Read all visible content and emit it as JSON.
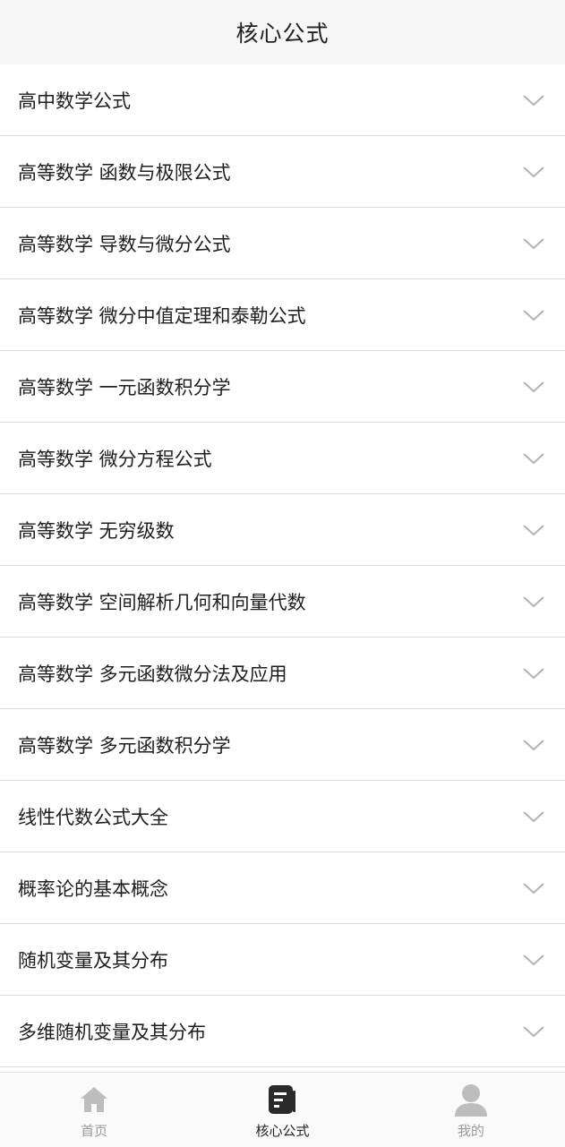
{
  "header": {
    "title": "核心公式"
  },
  "list": {
    "items": [
      {
        "label": "高中数学公式"
      },
      {
        "label": "高等数学 函数与极限公式"
      },
      {
        "label": "高等数学 导数与微分公式"
      },
      {
        "label": "高等数学 微分中值定理和泰勒公式"
      },
      {
        "label": "高等数学 一元函数积分学"
      },
      {
        "label": "高等数学 微分方程公式"
      },
      {
        "label": "高等数学 无穷级数"
      },
      {
        "label": "高等数学 空间解析几何和向量代数"
      },
      {
        "label": "高等数学 多元函数微分法及应用"
      },
      {
        "label": "高等数学 多元函数积分学"
      },
      {
        "label": "线性代数公式大全"
      },
      {
        "label": "概率论的基本概念"
      },
      {
        "label": "随机变量及其分布"
      },
      {
        "label": "多维随机变量及其分布"
      }
    ],
    "chevron_icon": "chevron-down-icon"
  },
  "tabbar": {
    "tabs": [
      {
        "label": "首页",
        "icon": "home-icon",
        "active": false
      },
      {
        "label": "核心公式",
        "icon": "book-icon",
        "active": true
      },
      {
        "label": "我的",
        "icon": "user-icon",
        "active": false
      }
    ]
  },
  "colors": {
    "header_bg": "#f6f6f6",
    "divider": "#d9d9d9",
    "tab_inactive": "#9a9a9a",
    "tab_active": "#222222",
    "chevron": "#b3b3b3"
  }
}
